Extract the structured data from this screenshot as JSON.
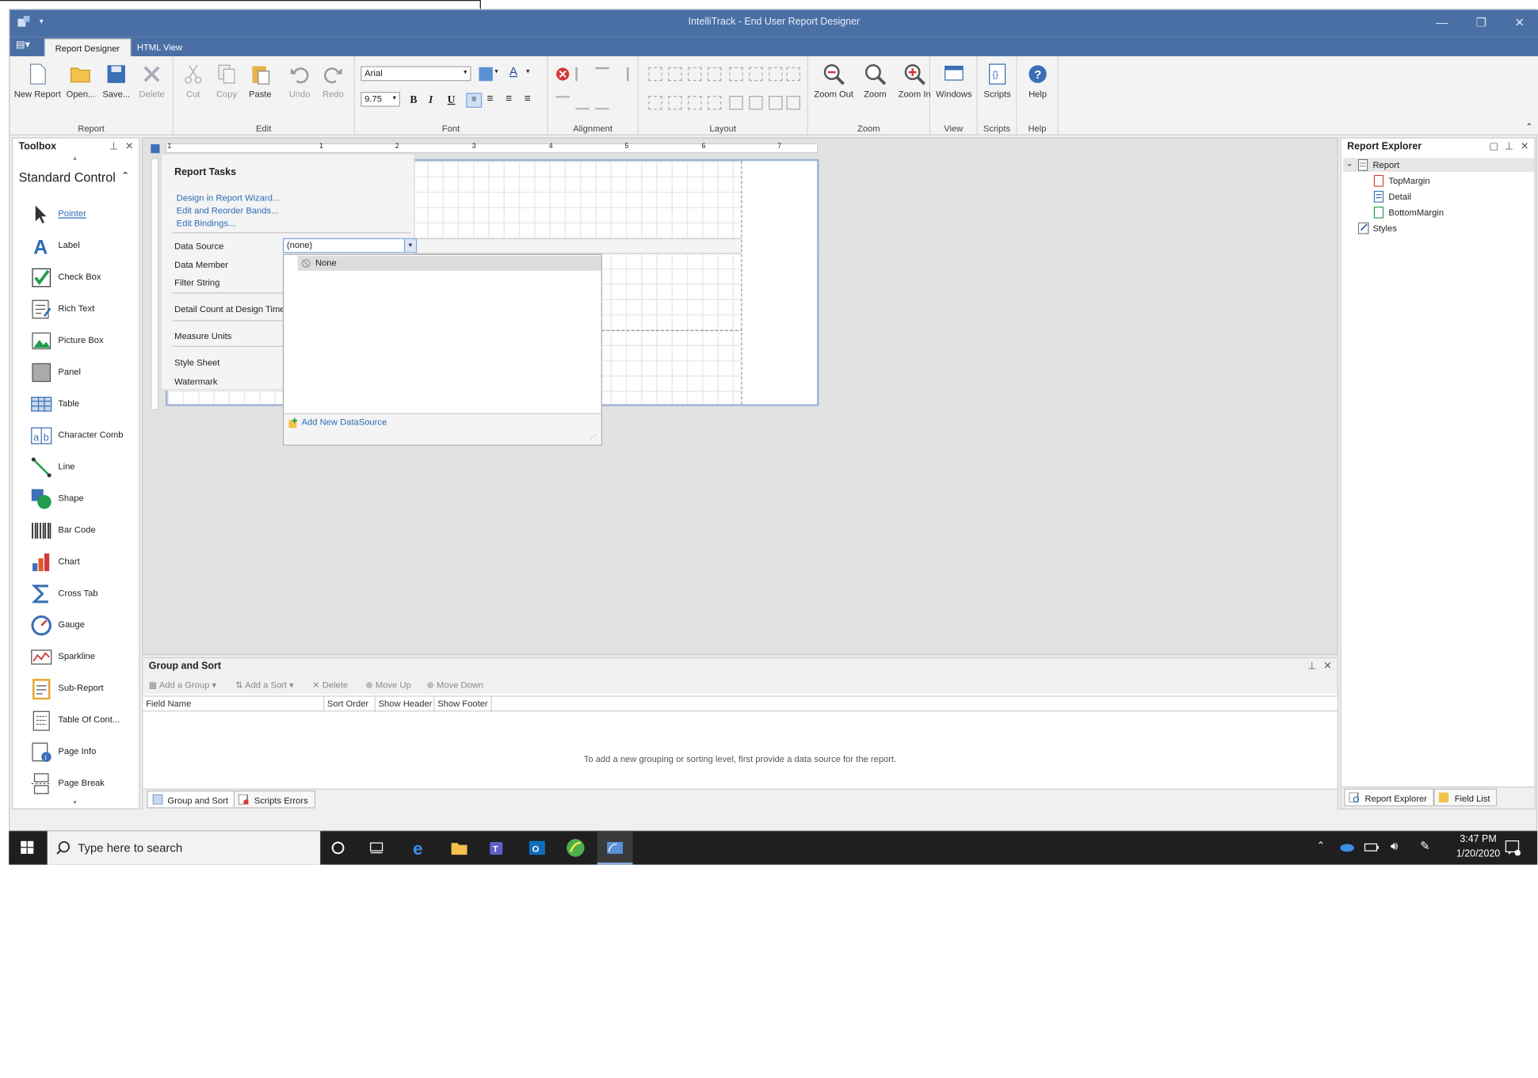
{
  "window": {
    "title": "IntelliTrack - End User Report Designer"
  },
  "ribbon": {
    "tabs": [
      "Report Designer",
      "HTML View"
    ],
    "groups": {
      "report": {
        "label": "Report",
        "buttons": [
          "New Report",
          "Open...",
          "Save...",
          "Delete"
        ]
      },
      "edit": {
        "label": "Edit",
        "buttons": [
          "Cut",
          "Copy",
          "Paste",
          "Undo",
          "Redo"
        ]
      },
      "font": {
        "label": "Font",
        "font_name": "Arial",
        "font_size": "9.75"
      },
      "alignment": {
        "label": "Alignment"
      },
      "layout": {
        "label": "Layout"
      },
      "zoom": {
        "label": "Zoom",
        "buttons": [
          "Zoom Out",
          "Zoom",
          "Zoom In"
        ]
      },
      "view": {
        "label": "View",
        "buttons": [
          "Windows"
        ]
      },
      "scripts": {
        "label": "Scripts",
        "buttons": [
          "Scripts"
        ]
      },
      "help": {
        "label": "Help",
        "buttons": [
          "Help"
        ]
      }
    }
  },
  "toolbox": {
    "title": "Toolbox",
    "section": "Standard Control",
    "items": [
      "Pointer",
      "Label",
      "Check Box",
      "Rich Text",
      "Picture Box",
      "Panel",
      "Table",
      "Character Comb",
      "Line",
      "Shape",
      "Bar Code",
      "Chart",
      "Cross Tab",
      "Gauge",
      "Sparkline",
      "Sub-Report",
      "Table Of Cont...",
      "Page Info",
      "Page Break"
    ]
  },
  "ruler": {
    "marks": [
      "1",
      "1",
      "2",
      "3",
      "4",
      "5",
      "6",
      "7"
    ]
  },
  "report_tasks": {
    "title": "Report Tasks",
    "links": [
      "Design in Report Wizard...",
      "Edit and Reorder Bands...",
      "Edit Bindings..."
    ],
    "props": [
      "Data Source",
      "Data Member",
      "Filter String",
      "Detail Count at Design Time",
      "Measure Units",
      "Style Sheet",
      "Watermark"
    ],
    "data_source_value": "(none)",
    "dropdown_option": "None",
    "add_datasource": "Add New DataSource"
  },
  "report_explorer": {
    "title": "Report Explorer",
    "root": "Report",
    "children": [
      "TopMargin",
      "Detail",
      "BottomMargin"
    ],
    "styles": "Styles",
    "tabs": [
      "Report Explorer",
      "Field List"
    ]
  },
  "group_sort": {
    "title": "Group and Sort",
    "toolbar": [
      "Add a Group",
      "Add a Sort",
      "Delete",
      "Move Up",
      "Move Down"
    ],
    "columns": [
      "Field Name",
      "Sort Order",
      "Show Header",
      "Show Footer"
    ],
    "empty_message": "To add a new grouping or sorting level, first provide a data source for the report.",
    "tabs": [
      "Group and Sort",
      "Scripts Errors"
    ]
  },
  "taskbar": {
    "search_placeholder": "Type here to search",
    "time": "3:47 PM",
    "date": "1/20/2020"
  },
  "colors": {
    "titlebar": "#4a6fa5",
    "accent": "#2e6bb5",
    "taskbar": "#1f1f1f"
  }
}
